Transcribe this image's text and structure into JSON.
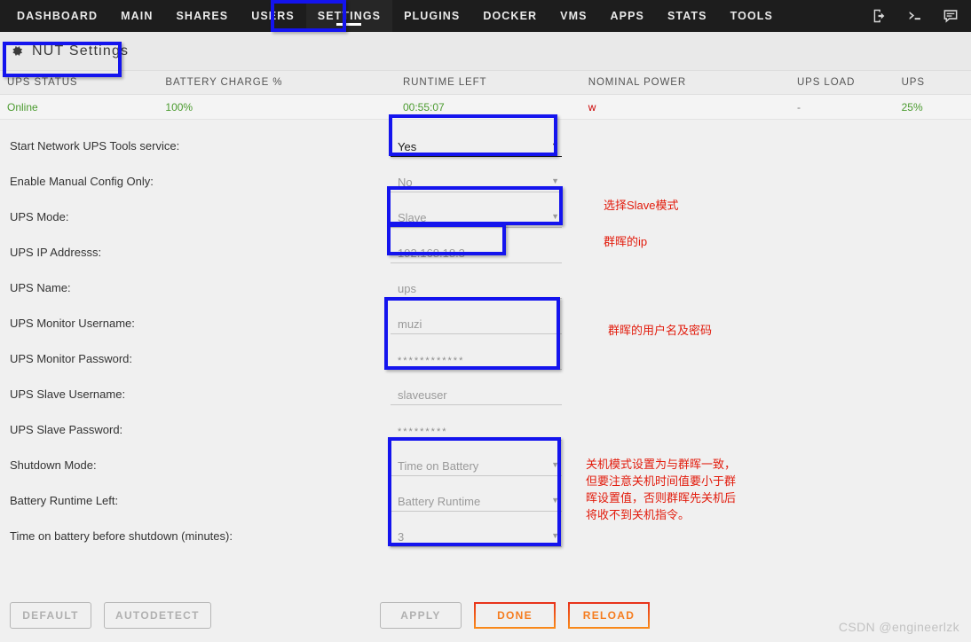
{
  "nav": {
    "items": [
      {
        "label": "DASHBOARD",
        "active": false
      },
      {
        "label": "MAIN",
        "active": false
      },
      {
        "label": "SHARES",
        "active": false
      },
      {
        "label": "USERS",
        "active": false
      },
      {
        "label": "SETTINGS",
        "active": true
      },
      {
        "label": "PLUGINS",
        "active": false
      },
      {
        "label": "DOCKER",
        "active": false
      },
      {
        "label": "VMS",
        "active": false
      },
      {
        "label": "APPS",
        "active": false
      },
      {
        "label": "STATS",
        "active": false
      },
      {
        "label": "TOOLS",
        "active": false
      }
    ],
    "icons": [
      "logout-icon",
      "terminal-icon",
      "chat-icon"
    ]
  },
  "header": {
    "title": "NUT Settings",
    "icon": "gear-icon"
  },
  "status_table": {
    "columns": [
      "UPS STATUS",
      "BATTERY CHARGE %",
      "RUNTIME LEFT",
      "NOMINAL POWER",
      "UPS LOAD",
      "UPS"
    ],
    "row": [
      "Online",
      "100%",
      "00:55:07",
      "w",
      "-",
      "25%"
    ]
  },
  "form": {
    "rows": [
      {
        "label": "Start Network UPS Tools service:",
        "type": "select",
        "value": "Yes",
        "enabled": true
      },
      {
        "label": "Enable Manual Config Only:",
        "type": "select",
        "value": "No",
        "enabled": false
      },
      {
        "label": "UPS Mode:",
        "type": "select",
        "value": "Slave",
        "enabled": false
      },
      {
        "label": "UPS IP Addresss:",
        "type": "text",
        "value": "192.168.18.3",
        "enabled": false
      },
      {
        "label": "UPS Name:",
        "type": "text",
        "value": "ups",
        "enabled": false
      },
      {
        "label": "UPS Monitor Username:",
        "type": "text",
        "value": "muzi",
        "enabled": false
      },
      {
        "label": "UPS Monitor Password:",
        "type": "password",
        "value": "************",
        "enabled": false
      },
      {
        "label": "UPS Slave Username:",
        "type": "text",
        "value": "slaveuser",
        "enabled": false
      },
      {
        "label": "UPS Slave Password:",
        "type": "password",
        "value": "*********",
        "enabled": false
      },
      {
        "label": "Shutdown Mode:",
        "type": "select",
        "value": "Time on Battery",
        "enabled": false
      },
      {
        "label": "Battery Runtime Left:",
        "type": "select",
        "value": "Battery Runtime",
        "enabled": false
      },
      {
        "label": "Time on battery before shutdown (minutes):",
        "type": "select",
        "value": "3",
        "enabled": false
      }
    ]
  },
  "annotations": [
    {
      "text": "选择Slave模式"
    },
    {
      "text": "群晖的ip"
    },
    {
      "text": "群晖的用户名及密码"
    },
    {
      "text": "关机模式设置为与群晖一致，但要注意关机时间值要小于群晖设置值，否则群晖先关机后将收不到关机指令。"
    }
  ],
  "footer": {
    "left_buttons": [
      {
        "label": "DEFAULT",
        "style": "gray"
      },
      {
        "label": "AUTODETECT",
        "style": "gray"
      }
    ],
    "right_buttons": [
      {
        "label": "APPLY",
        "style": "gray"
      },
      {
        "label": "DONE",
        "style": "accent"
      },
      {
        "label": "RELOAD",
        "style": "accent"
      }
    ]
  },
  "watermark": "CSDN @engineerlzk",
  "colors": {
    "highlight": "#1414ee",
    "annotation": "#e21b0c",
    "accent": "#f57c1f",
    "online": "#4b9b2f",
    "nav_bg": "#1d1d1d"
  }
}
